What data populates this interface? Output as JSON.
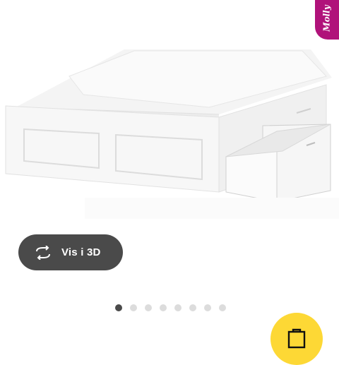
{
  "badge": {
    "text": "Molly",
    "color": "#b0127a"
  },
  "product": {
    "image_icon": "bed-with-storage-drawers-image"
  },
  "view_3d": {
    "label": "Vis i 3D",
    "icon": "rotate-3d-icon"
  },
  "carousel": {
    "total_dots": 8,
    "active_index": 0
  },
  "fab": {
    "icon": "shopping-bag-icon",
    "color": "#fdd835"
  }
}
